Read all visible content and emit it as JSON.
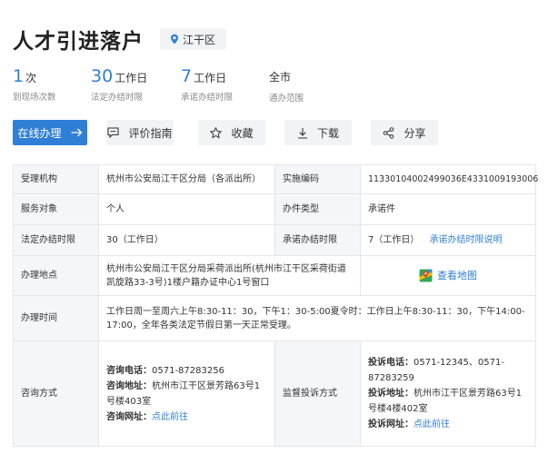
{
  "header": {
    "title": "人才引进落户",
    "region": "江干区"
  },
  "stats": [
    {
      "num": "1",
      "unit": "次",
      "label": "到现场次数"
    },
    {
      "num": "30",
      "unit": "工作日",
      "label": "法定办结时限"
    },
    {
      "num": "7",
      "unit": "工作日",
      "label": "承诺办结时限"
    },
    {
      "num": "",
      "unit": "全市",
      "label": "通办范围"
    }
  ],
  "actions": {
    "online": "在线办理",
    "guide": "评价指南",
    "favorite": "收藏",
    "download": "下载",
    "share": "分享"
  },
  "table": {
    "agency_label": "受理机构",
    "agency_value": "杭州市公安局江干区分局（各派出所）",
    "code_label": "实施编码",
    "code_value": "11330104002499036E4331009193006",
    "target_label": "服务对象",
    "target_value": "个人",
    "type_label": "办件类型",
    "type_value": "承诺件",
    "legal_limit_label": "法定办结时限",
    "legal_limit_value": "30（工作日）",
    "promise_limit_label": "承诺办结时限",
    "promise_limit_value": "7（工作日）",
    "promise_limit_link": "承诺办结时限说明",
    "location_label": "办理地点",
    "location_value": "杭州市公安局江干区分局采荷派出所(杭州市江干区采荷街道凯旋路33-3号)1楼户籍办证中心1号窗口",
    "map_link": "查看地图",
    "hours_label": "办理时间",
    "hours_value": "工作日周一至周六上午8:30-11：30，下午1：30-5:00夏令时：工作日上午8:30-11：30，下午14:00-17:00，全年各类法定节假日第一天正常受理。",
    "consult_label": "咨询方式",
    "consult_phone_label": "咨询电话：",
    "consult_phone": "0571-87283256",
    "consult_addr_label": "咨询地址：",
    "consult_addr": "杭州市江干区景芳路63号1号楼403室",
    "consult_web_label": "咨询网址：",
    "consult_web": "点此前往",
    "complaint_label": "监督投诉方式",
    "complaint_phone_label": "投诉电话：",
    "complaint_phone": "0571-12345、0571-87283259",
    "complaint_addr_label": "投诉地址：",
    "complaint_addr": "杭州市江干区景芳路63号1号楼4楼402室",
    "complaint_web_label": "投诉网址：",
    "complaint_web": "点此前往"
  },
  "colors": {
    "accent": "#2f7fd6",
    "label_bg": "#f5f6f8"
  }
}
